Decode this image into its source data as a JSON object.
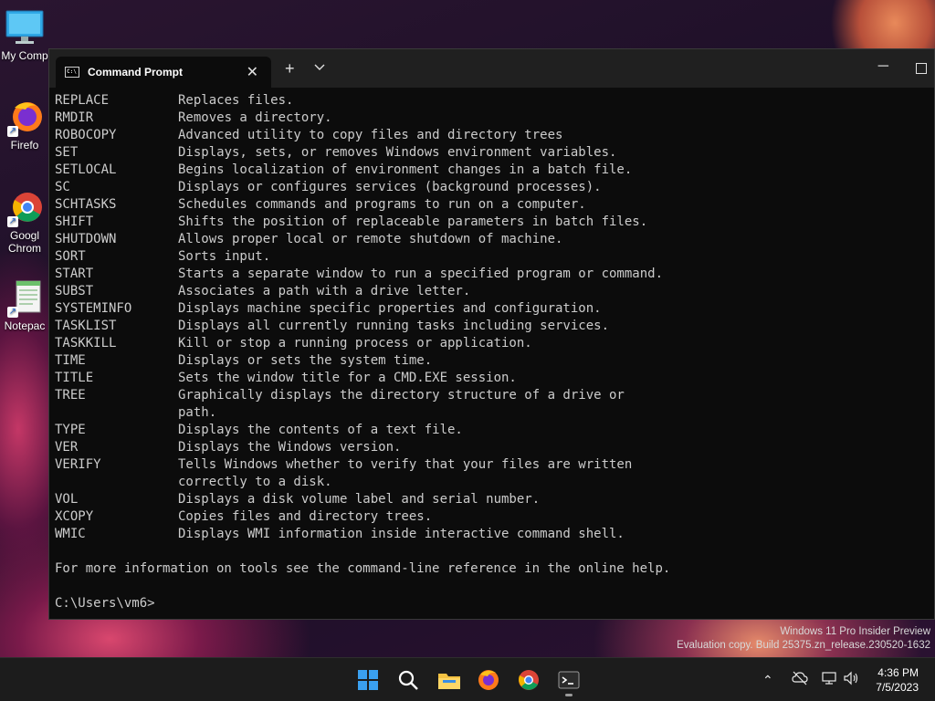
{
  "desktop": {
    "icons": [
      {
        "label": "My Comp",
        "icon": "computer-icon"
      },
      {
        "label": "Firefo",
        "icon": "firefox-icon"
      },
      {
        "label": "Googl Chrom",
        "icon": "chrome-icon"
      },
      {
        "label": "Notepac",
        "icon": "notepad-icon"
      }
    ]
  },
  "window": {
    "tab_title": "Command Prompt",
    "close_glyph": "✕",
    "new_tab_glyph": "+",
    "dropdown_glyph": "⌄",
    "minimize_glyph": "─"
  },
  "console": {
    "lines": [
      {
        "cmd": "REPLACE",
        "desc": "Replaces files."
      },
      {
        "cmd": "RMDIR",
        "desc": "Removes a directory."
      },
      {
        "cmd": "ROBOCOPY",
        "desc": "Advanced utility to copy files and directory trees"
      },
      {
        "cmd": "SET",
        "desc": "Displays, sets, or removes Windows environment variables."
      },
      {
        "cmd": "SETLOCAL",
        "desc": "Begins localization of environment changes in a batch file."
      },
      {
        "cmd": "SC",
        "desc": "Displays or configures services (background processes)."
      },
      {
        "cmd": "SCHTASKS",
        "desc": "Schedules commands and programs to run on a computer."
      },
      {
        "cmd": "SHIFT",
        "desc": "Shifts the position of replaceable parameters in batch files."
      },
      {
        "cmd": "SHUTDOWN",
        "desc": "Allows proper local or remote shutdown of machine."
      },
      {
        "cmd": "SORT",
        "desc": "Sorts input."
      },
      {
        "cmd": "START",
        "desc": "Starts a separate window to run a specified program or command."
      },
      {
        "cmd": "SUBST",
        "desc": "Associates a path with a drive letter."
      },
      {
        "cmd": "SYSTEMINFO",
        "desc": "Displays machine specific properties and configuration."
      },
      {
        "cmd": "TASKLIST",
        "desc": "Displays all currently running tasks including services."
      },
      {
        "cmd": "TASKKILL",
        "desc": "Kill or stop a running process or application."
      },
      {
        "cmd": "TIME",
        "desc": "Displays or sets the system time."
      },
      {
        "cmd": "TITLE",
        "desc": "Sets the window title for a CMD.EXE session."
      },
      {
        "cmd": "TREE",
        "desc": "Graphically displays the directory structure of a drive or"
      },
      {
        "cmd": "",
        "desc": "path."
      },
      {
        "cmd": "TYPE",
        "desc": "Displays the contents of a text file."
      },
      {
        "cmd": "VER",
        "desc": "Displays the Windows version."
      },
      {
        "cmd": "VERIFY",
        "desc": "Tells Windows whether to verify that your files are written"
      },
      {
        "cmd": "",
        "desc": "correctly to a disk."
      },
      {
        "cmd": "VOL",
        "desc": "Displays a disk volume label and serial number."
      },
      {
        "cmd": "XCOPY",
        "desc": "Copies files and directory trees."
      },
      {
        "cmd": "WMIC",
        "desc": "Displays WMI information inside interactive command shell."
      },
      {
        "cmd": "",
        "desc": ""
      },
      {
        "cmd": "For more information on tools see the command-line reference in the online help.",
        "desc": ""
      },
      {
        "cmd": "",
        "desc": ""
      },
      {
        "cmd": "C:\\Users\\vm6>",
        "desc": ""
      }
    ]
  },
  "watermark": {
    "line1": "Windows 11 Pro Insider Preview",
    "line2": "Evaluation copy. Build 25375.zn_release.230520-1632"
  },
  "taskbar": {
    "apps": [
      "start-icon",
      "search-icon",
      "file-explorer-icon",
      "firefox-icon",
      "chrome-icon",
      "terminal-icon"
    ],
    "tray": {
      "chevron": "⌃"
    },
    "time": "4:36 PM",
    "date": "7/5/2023"
  }
}
